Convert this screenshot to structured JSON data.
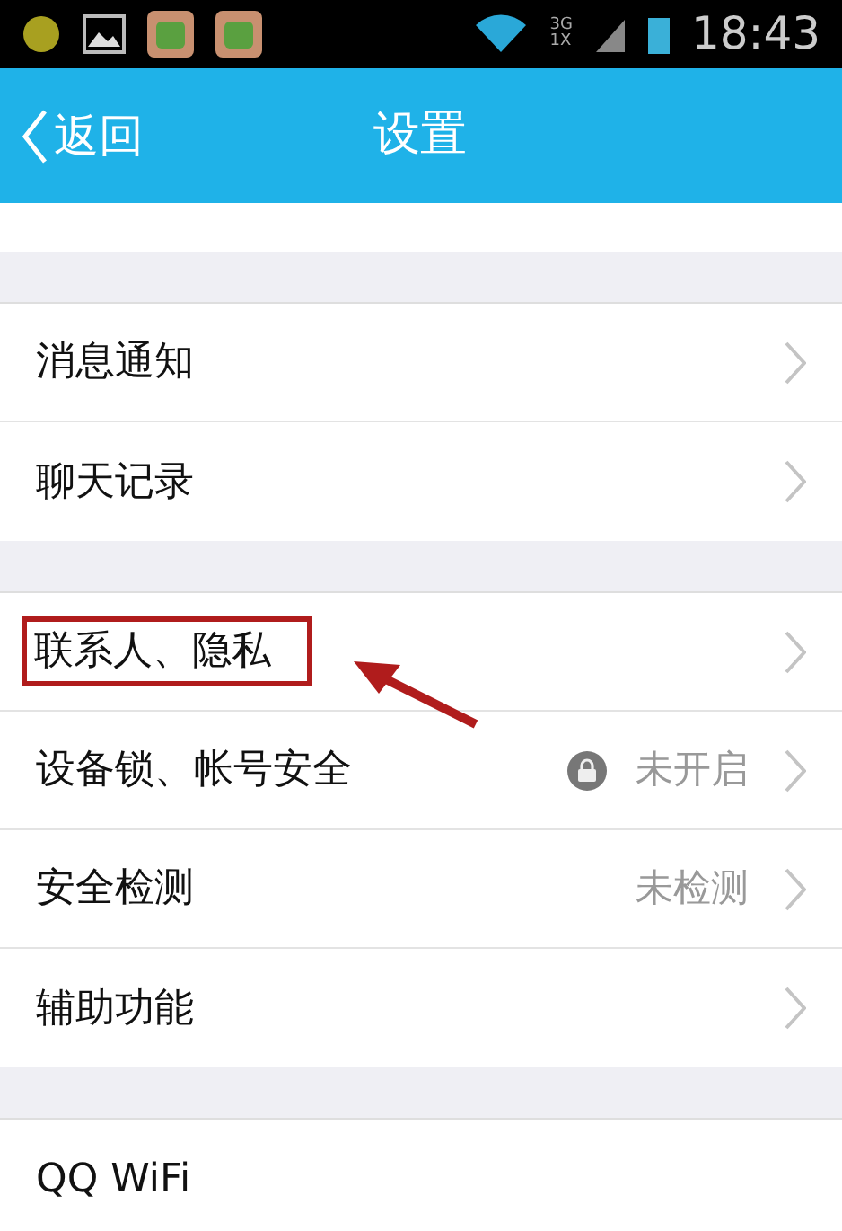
{
  "status_bar": {
    "time": "18:43",
    "network": "3G",
    "network_2": "1X"
  },
  "header": {
    "back": "返回",
    "title": "设置"
  },
  "groups": [
    {
      "rows": [
        {
          "label": "消息通知",
          "chevron": true,
          "highlighted": false,
          "lock_icon": false
        },
        {
          "label": "聊天记录",
          "chevron": true,
          "highlighted": false,
          "lock_icon": false
        }
      ]
    },
    {
      "rows": [
        {
          "label": "联系人、隐私",
          "chevron": true,
          "highlighted": true,
          "lock_icon": false
        },
        {
          "label": "设备锁、帐号安全",
          "value": "未开启",
          "chevron": true,
          "highlighted": false,
          "lock_icon": true
        },
        {
          "label": "安全检测",
          "value": "未检测",
          "chevron": true,
          "highlighted": false,
          "lock_icon": false
        },
        {
          "label": "辅助功能",
          "chevron": true,
          "highlighted": false,
          "lock_icon": false
        }
      ]
    },
    {
      "rows": [
        {
          "label": "QQ WiFi",
          "chevron": false,
          "highlighted": false,
          "lock_icon": false
        }
      ]
    }
  ]
}
